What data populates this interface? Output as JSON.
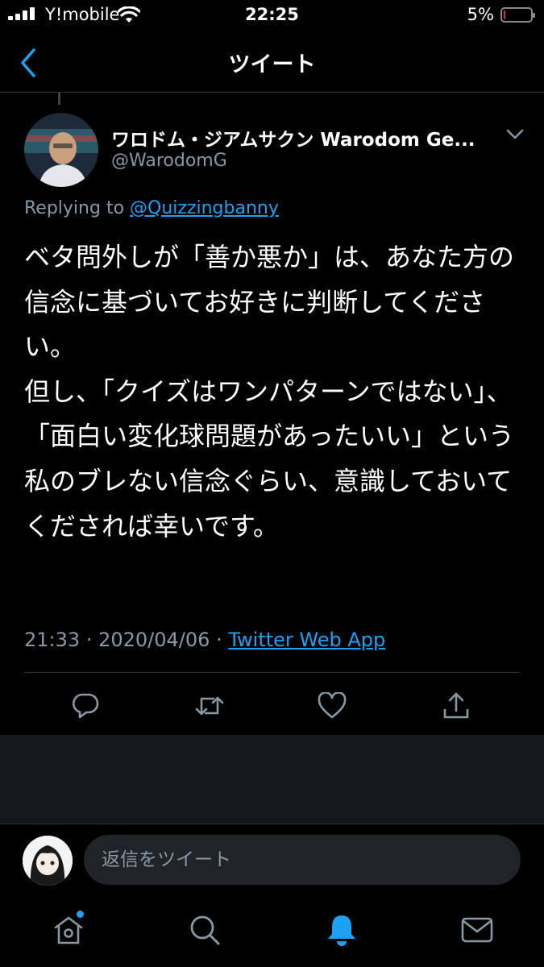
{
  "status_bar": {
    "carrier": "Y!mobile",
    "time": "22:25",
    "battery": "5%",
    "battery_level": 0.05,
    "battery_color": "#e0245e"
  },
  "nav": {
    "back_icon": "chevron-left-icon",
    "title": "ツイート"
  },
  "tweet": {
    "author_name": "ワロドム・ジアムサクン  Warodom Ge...",
    "author_handle": "@WarodomG",
    "replying_label": "Replying to",
    "replying_to": "@Quizzingbanny",
    "text": "ベタ問外しが「善か悪か」は、あなた方の信念に基づいてお好きに判断してください。\n但し、「クイズはワンパターンではない」、「面白い変化球問題があったいい」という私のブレない信念ぐらい、意識しておいてくだされば幸いです。",
    "time": "21:33",
    "date": "2020/04/06",
    "separator": "·",
    "source_app": "Twitter Web App"
  },
  "actions": [
    "reply-icon",
    "retweet-icon",
    "like-icon",
    "share-icon"
  ],
  "reply_bar": {
    "placeholder": "返信をツイート"
  },
  "tabs": [
    "home-icon",
    "search-icon",
    "notifications-icon",
    "messages-icon"
  ],
  "colors": {
    "accent": "#1da1f2",
    "secondary_text": "#8899a6",
    "divider": "#2f3336"
  }
}
